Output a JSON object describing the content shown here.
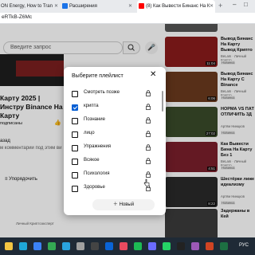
{
  "browser": {
    "tabs": [
      {
        "label": "ON Energy, How to Tran",
        "icon": "ai-tab-icon",
        "color": "#5f6368"
      },
      {
        "label": "Расширения",
        "icon": "puzzle-icon",
        "color": "#1a73e8"
      },
      {
        "label": "(8) Как Вывести Бинанс На К",
        "icon": "youtube-icon",
        "color": "#ff0000"
      }
    ],
    "url_fragment": "eRTkB-Z6Mc"
  },
  "page": {
    "search_placeholder": "Введите запрос",
    "video_title": "Карту 2025 | Инстру Binance На Карту",
    "subscribed_label": "подписаны",
    "description_label": "азад",
    "description_snippet": "м комментарии под этим ви",
    "sort_label": "Упорядочить",
    "channel_footer": "Личный Криптоэксперт"
  },
  "recommendations": [
    {
      "title": "может начаться",
      "meta": "",
      "duration": "",
      "badge": "",
      "color": "#555"
    },
    {
      "title": "Вывод Бинанс На Карту Вывод Крипто",
      "meta": "BeLam · Личный Крипто",
      "duration": "11:04",
      "badge": "Новинка",
      "color": "#8a1c1c"
    },
    {
      "title": "Вывод Бинанс На Карту С Binance",
      "meta": "BeLam · Личный Крипто",
      "duration": "6:06",
      "badge": "Новинка",
      "color": "#6b3a1e"
    },
    {
      "title": "НОРМА VS ПАТ ОТЛИЧИТЬ 3Д",
      "meta": "Артём Нинцков",
      "duration": "27:02",
      "badge": "Новинка",
      "color": "#3a4b2a"
    },
    {
      "title": "Как Вывести Бина На Карту Без 1",
      "meta": "BeLam · Личный Крипто",
      "duration": "4:51",
      "badge": "Новинка",
      "color": "#7a1f2b"
    },
    {
      "title": "Шестёрки лиже идеализму",
      "meta": "Артём Нинцков",
      "duration": "8:22",
      "badge": "Новинка",
      "color": "#2a2a2a"
    },
    {
      "title": "Задержаны в Кей",
      "meta": "",
      "duration": "",
      "badge": "",
      "color": "#3b3b3b"
    }
  ],
  "dialog": {
    "title": "Выберите плейлист",
    "close_label": "✕",
    "playlists": [
      {
        "label": "Смотреть позже",
        "checked": false
      },
      {
        "label": "крипта",
        "checked": true
      },
      {
        "label": "Познание",
        "checked": false
      },
      {
        "label": "лицо",
        "checked": false
      },
      {
        "label": "Упражнения",
        "checked": false
      },
      {
        "label": "Всякое",
        "checked": false
      },
      {
        "label": "Психология",
        "checked": false
      },
      {
        "label": "Здоровье",
        "checked": false
      }
    ],
    "new_label": "Новый"
  },
  "taskbar": {
    "icons": [
      {
        "name": "file-explorer-icon",
        "color": "#f4c542"
      },
      {
        "name": "edge-icon",
        "color": "#1fa7d8"
      },
      {
        "name": "store-icon",
        "color": "#3b82f6"
      },
      {
        "name": "chrome-icon",
        "color": "#34a853"
      },
      {
        "name": "telegram-icon",
        "color": "#2aa3df"
      },
      {
        "name": "settings-icon",
        "color": "#a0a0a0"
      },
      {
        "name": "terminal-icon",
        "color": "#444444"
      },
      {
        "name": "mail-icon",
        "color": "#0a64d6"
      },
      {
        "name": "music-icon",
        "color": "#e84a5f"
      },
      {
        "name": "spotify-icon",
        "color": "#1db954"
      },
      {
        "name": "vpn-icon",
        "color": "#6b6bff"
      },
      {
        "name": "whatsapp-icon",
        "color": "#25d366"
      },
      {
        "name": "game-icon",
        "color": "#222222"
      },
      {
        "name": "people-icon",
        "color": "#9b59b6"
      },
      {
        "name": "ppt-icon",
        "color": "#d04423"
      },
      {
        "name": "excel-icon",
        "color": "#1d6f42"
      }
    ],
    "language": "РУС"
  }
}
